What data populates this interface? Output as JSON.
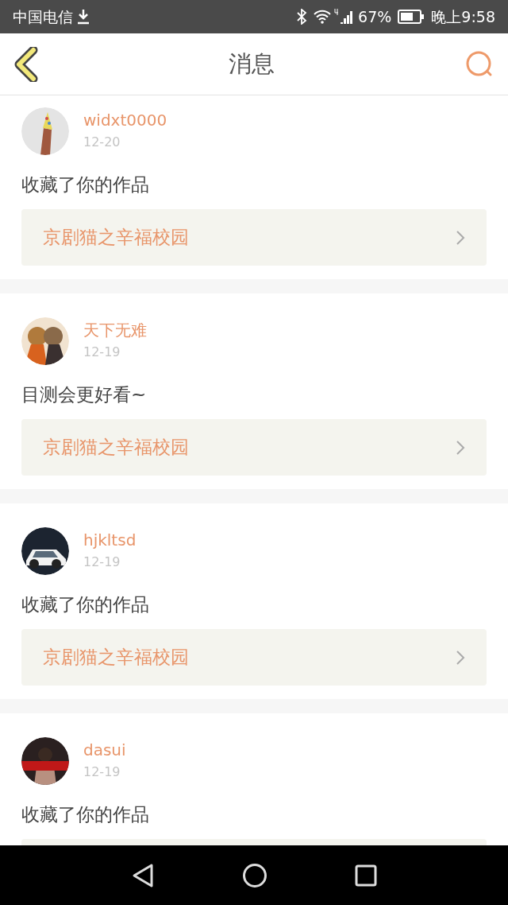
{
  "status_bar": {
    "carrier": "中国电信",
    "battery": "67%",
    "time": "晚上9:58"
  },
  "header": {
    "title": "消息"
  },
  "messages": [
    {
      "user": "widxt0000",
      "date": "12-20",
      "text": "收藏了你的作品",
      "work": "京剧猫之辛福校园"
    },
    {
      "user": "天下无难",
      "date": "12-19",
      "text": "目测会更好看~",
      "work": "京剧猫之辛福校园"
    },
    {
      "user": "hjkltsd",
      "date": "12-19",
      "text": "收藏了你的作品",
      "work": "京剧猫之辛福校园"
    },
    {
      "user": "dasui",
      "date": "12-19",
      "text": "收藏了你的作品"
    }
  ]
}
